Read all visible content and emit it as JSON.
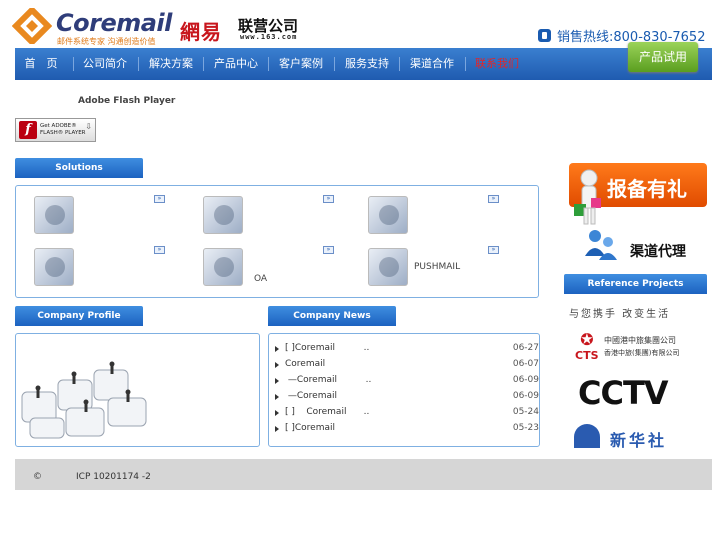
{
  "header": {
    "logo_text": "Coremail",
    "logo_slogan": "邮件系统专家 沟通创造价值",
    "partner_mark": "網易",
    "partner_name": "联营公司",
    "partner_url": "www.163.com",
    "hotline": "销售热线:800-830-7652",
    "trial_button": "产品试用"
  },
  "nav": {
    "items": [
      {
        "label": "首　页",
        "active": false
      },
      {
        "label": "公司简介",
        "active": false
      },
      {
        "label": "解决方案",
        "active": false
      },
      {
        "label": "产品中心",
        "active": false
      },
      {
        "label": "客户案例",
        "active": false
      },
      {
        "label": "服务支持",
        "active": false
      },
      {
        "label": "渠道合作",
        "active": false
      },
      {
        "label": "联系我们",
        "active": true
      }
    ],
    "active_color": "#e0262a"
  },
  "flash": {
    "title": "Adobe Flash Player",
    "badge_line1": "Get ADOBE®",
    "badge_line2": "FLASH® PLAYER"
  },
  "solutions": {
    "tab_label": "Solutions",
    "items": [
      {
        "label": ""
      },
      {
        "label": ""
      },
      {
        "label": ""
      },
      {
        "label": ""
      },
      {
        "label": "OA"
      },
      {
        "label": "PUSHMAIL"
      }
    ]
  },
  "company_profile": {
    "tab_label": "Company Profile"
  },
  "company_news": {
    "tab_label": "Company News",
    "items": [
      {
        "title": "[ ]Coremail          ..",
        "date": "06-27"
      },
      {
        "title": "Coremail",
        "date": "06-07"
      },
      {
        "title": " —Coremail          ..",
        "date": "06-09"
      },
      {
        "title": " —Coremail",
        "date": "06-09"
      },
      {
        "title": "[ ]    Coremail      ..",
        "date": "05-24"
      },
      {
        "title": "[ ]Coremail",
        "date": "05-23"
      }
    ]
  },
  "right_column": {
    "promo_banner": "报备有礼",
    "channel_label": "渠道代理",
    "reference_tab": "Reference Projects",
    "slogan": "与您携手 改变生活",
    "cts_line1": "中國港中旅集團公司",
    "cts_line2": "香港中旅(集團)有限公司",
    "cts_abbr": "CTS",
    "cctv": "CCTV",
    "xinhua": "新华社"
  },
  "footer": {
    "copyright": "©",
    "icp": "ICP 10201174 -2"
  },
  "colors": {
    "nav_blue": "#1f5bb0",
    "tab_blue": "#1c62c0",
    "panel_border": "#7fb0e2",
    "trial_green": "#5a9e1f",
    "promo_orange": "#ff7a1a"
  }
}
